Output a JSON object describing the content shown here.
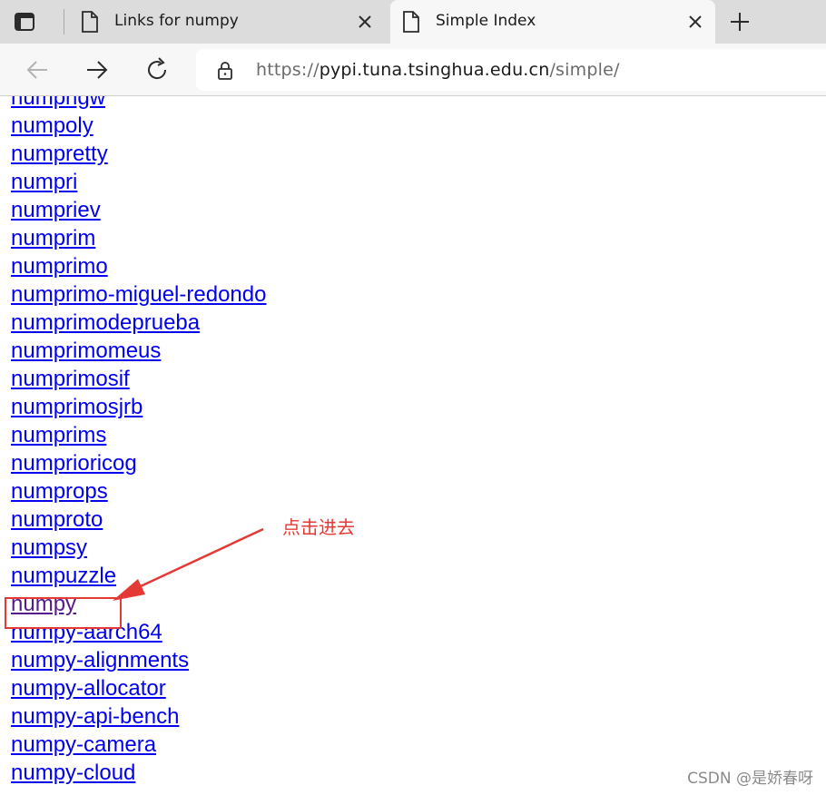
{
  "browser": {
    "tabs": [
      {
        "title": "Links for numpy",
        "icon": "page-icon",
        "active": false
      },
      {
        "title": "Simple Index",
        "icon": "page-icon",
        "active": true
      }
    ],
    "address": {
      "scheme": "https://",
      "host": "pypi.tuna.tsinghua.edu.cn",
      "path": "/simple/"
    }
  },
  "content": {
    "links": [
      {
        "text": "numpngw"
      },
      {
        "text": "numpoly"
      },
      {
        "text": "numpretty"
      },
      {
        "text": "numpri"
      },
      {
        "text": "numpriev"
      },
      {
        "text": "numprim"
      },
      {
        "text": "numprimo"
      },
      {
        "text": "numprimo-miguel-redondo"
      },
      {
        "text": "numprimodeprueba"
      },
      {
        "text": "numprimomeus"
      },
      {
        "text": "numprimosif"
      },
      {
        "text": "numprimosjrb"
      },
      {
        "text": "numprims"
      },
      {
        "text": "numprioricog"
      },
      {
        "text": "numprops"
      },
      {
        "text": "numproto"
      },
      {
        "text": "numpsy"
      },
      {
        "text": "numpuzzle"
      },
      {
        "text": "numpy",
        "visited": true
      },
      {
        "text": "numpy-aarch64"
      },
      {
        "text": "numpy-alignments"
      },
      {
        "text": "numpy-allocator"
      },
      {
        "text": "numpy-api-bench"
      },
      {
        "text": "numpy-camera"
      },
      {
        "text": "numpy-cloud"
      }
    ]
  },
  "annotation": {
    "note": "点击进去",
    "color": "#e53935"
  },
  "watermark": "CSDN @是娇春呀",
  "colors": {
    "link": "#0000ee",
    "visited_link": "#551a8b",
    "tabstrip": "#dcdcdc",
    "toolbar": "#f7f7f7"
  }
}
